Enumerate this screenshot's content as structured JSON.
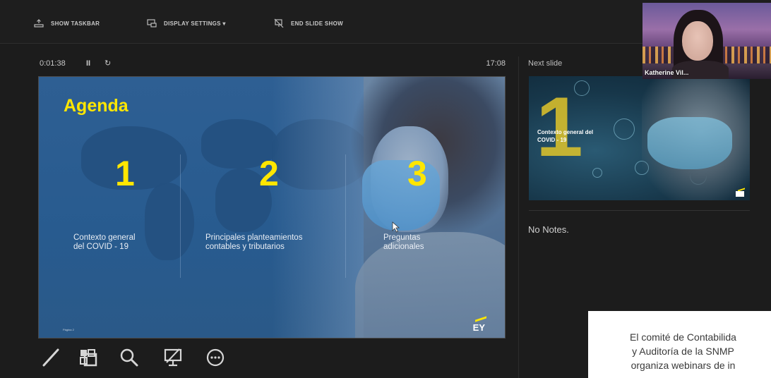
{
  "toolbar": {
    "show_taskbar": "SHOW TASKBAR",
    "display_settings": "DISPLAY SETTINGS ▾",
    "end_slide_show": "END SLIDE SHOW"
  },
  "presenter": {
    "elapsed_time": "0:01:38",
    "pause_glyph": "II",
    "restart_glyph": "↻",
    "clock": "17:08"
  },
  "slide": {
    "title": "Agenda",
    "items": [
      {
        "number": "1",
        "text_line1": "Contexto general",
        "text_line2": "del COVID - 19"
      },
      {
        "number": "2",
        "text_line1": "Principales planteamientos",
        "text_line2": "contables y tributarios"
      },
      {
        "number": "3",
        "text_line1": "Preguntas",
        "text_line2": "adicionales"
      }
    ],
    "footer": "Página 2",
    "logo": "EY"
  },
  "tools": {
    "icons": [
      "pen-icon",
      "slides-grid-icon",
      "zoom-icon",
      "screen-icon",
      "more-icon"
    ]
  },
  "next_slide": {
    "label": "Next slide",
    "big_number": "1",
    "caption_line1": "Contexto general del",
    "caption_line2": "COVID - 19"
  },
  "notes": {
    "text": "No Notes."
  },
  "webcam": {
    "name": "Katherine Vil..."
  },
  "overlay": {
    "line1": "El comité de Contabilida",
    "line2": "y Auditoría de la SNMP",
    "line3": "organiza webinars de in"
  },
  "colors": {
    "accent_yellow": "#ffe600",
    "background": "#1c1c1c"
  }
}
